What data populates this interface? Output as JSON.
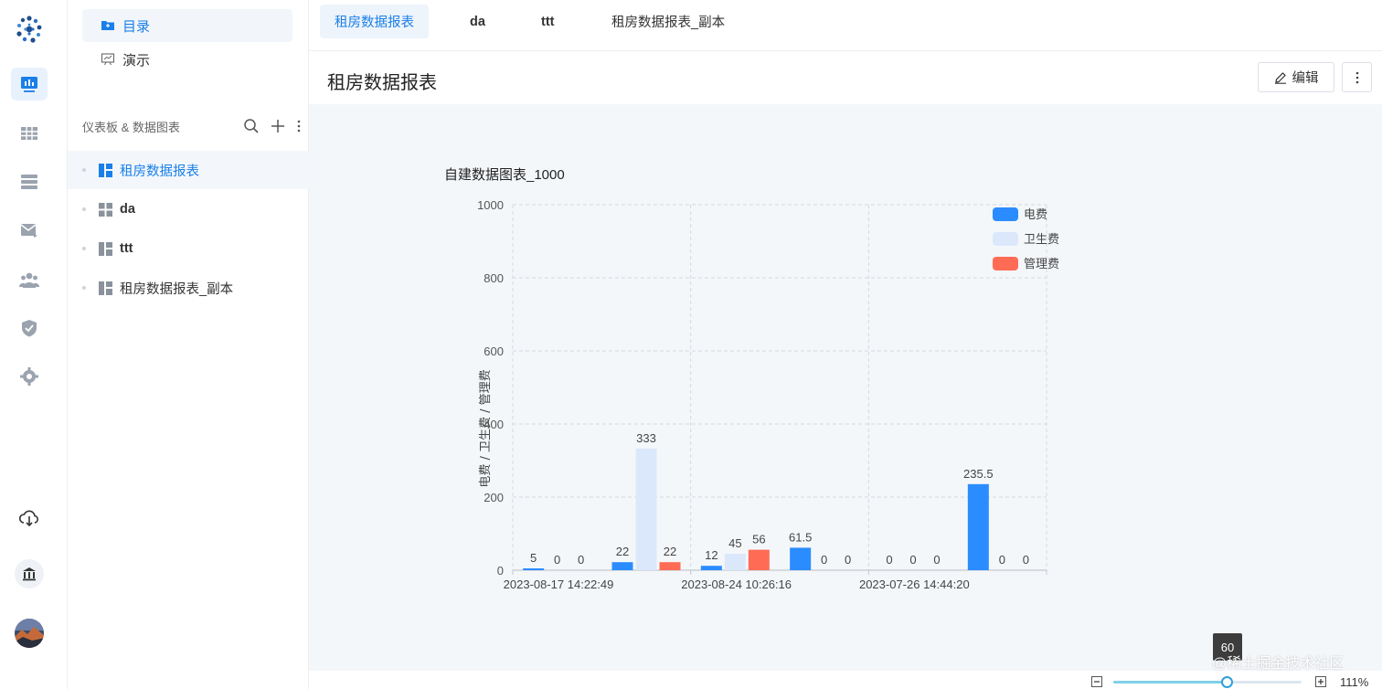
{
  "sidebar": {
    "nav": [
      {
        "label": "目录",
        "icon": "folder-icon",
        "active": true
      },
      {
        "label": "演示",
        "icon": "presentation-icon",
        "active": false
      }
    ],
    "section_title": "仪表板 & 数据图表",
    "tree": [
      {
        "label": "租房数据报表",
        "icon": "dashboard-icon",
        "active": true
      },
      {
        "label": "da",
        "icon": "grid-icon",
        "active": false
      },
      {
        "label": "ttt",
        "icon": "dashboard-icon",
        "active": false
      },
      {
        "label": "租房数据报表_副本",
        "icon": "dashboard-icon",
        "active": false
      }
    ]
  },
  "tabs": [
    {
      "label": "租房数据报表",
      "active": true
    },
    {
      "label": "da",
      "active": false
    },
    {
      "label": "ttt",
      "active": false
    },
    {
      "label": "租房数据报表_副本",
      "active": false
    }
  ],
  "header": {
    "title": "租房数据报表",
    "edit_label": "编辑"
  },
  "footer": {
    "zoom_label": "111%",
    "zoom_tooltip": "60",
    "zoom_fraction": 0.6,
    "watermark": "@稀土掘金技术社区"
  },
  "colors": {
    "accent": "#1a7fe8",
    "series1": "#2b8cff",
    "series2": "#dbe8fb",
    "series3": "#ff6b54"
  },
  "chart_data": {
    "type": "bar",
    "title": "自建数据图表_1000",
    "xlabel": "",
    "ylabel": "电费 / 卫生费 / 管理费",
    "ylim": [
      0,
      1000
    ],
    "yticks": [
      0,
      200,
      400,
      600,
      800,
      1000
    ],
    "grid": true,
    "legend_position": "top-right",
    "categories": [
      "2023-08-17 14:22:49",
      "",
      "2023-08-24 10:26:16",
      "",
      "2023-07-26 14:44:20",
      ""
    ],
    "series": [
      {
        "name": "电费",
        "values": [
          5,
          22,
          12,
          61.5,
          0,
          235.5
        ]
      },
      {
        "name": "卫生费",
        "values": [
          0,
          333,
          45,
          0,
          0,
          0
        ]
      },
      {
        "name": "管理费",
        "values": [
          0,
          22,
          56,
          0,
          0,
          0
        ]
      }
    ]
  }
}
